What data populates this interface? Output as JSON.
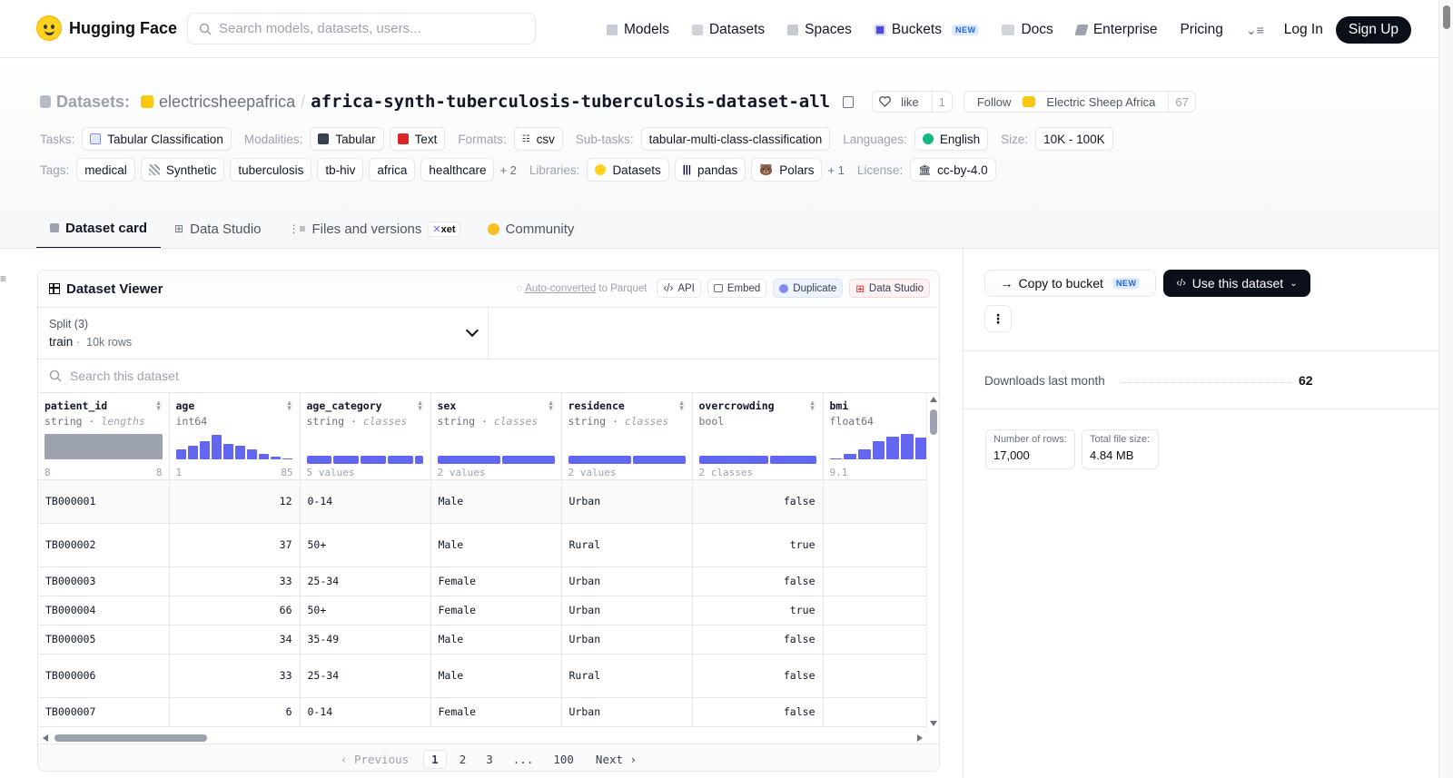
{
  "nav": {
    "brand": "Hugging Face",
    "search_placeholder": "Search models, datasets, users...",
    "links": [
      {
        "label": "Models",
        "icon": "cube-icon"
      },
      {
        "label": "Datasets",
        "icon": "database-icon"
      },
      {
        "label": "Spaces",
        "icon": "grid-icon"
      },
      {
        "label": "Buckets",
        "icon": "bucket-icon",
        "badge": "NEW"
      },
      {
        "label": "Docs",
        "icon": "book-icon"
      },
      {
        "label": "Enterprise",
        "icon": "enterprise-icon"
      },
      {
        "label": "Pricing"
      }
    ],
    "login": "Log In",
    "signup": "Sign Up"
  },
  "repo": {
    "kind_label": "Datasets:",
    "org": "electricsheepafrica",
    "name": "africa-synth-tuberculosis-tuberculosis-dataset-all",
    "like_label": "like",
    "like_count": "1",
    "follow_label": "Follow",
    "follow_org": "Electric Sheep Africa",
    "follow_count": "67"
  },
  "meta": {
    "tasks_label": "Tasks:",
    "task": "Tabular Classification",
    "modalities_label": "Modalities:",
    "modalities": [
      "Tabular",
      "Text"
    ],
    "formats_label": "Formats:",
    "format": "csv",
    "subtasks_label": "Sub-tasks:",
    "subtask": "tabular-multi-class-classification",
    "languages_label": "Languages:",
    "language": "English",
    "size_label": "Size:",
    "size": "10K - 100K",
    "tags_label": "Tags:",
    "tags": [
      "medical",
      "Synthetic",
      "tuberculosis",
      "tb-hiv",
      "africa",
      "healthcare"
    ],
    "tags_more": "+ 2",
    "libraries_label": "Libraries:",
    "libraries": [
      "Datasets",
      "pandas",
      "Polars"
    ],
    "libraries_more": "+ 1",
    "license_label": "License:",
    "license": "cc-by-4.0"
  },
  "tabs": {
    "card": "Dataset card",
    "studio": "Data Studio",
    "files": "Files and versions",
    "files_badge": "xet",
    "community": "Community"
  },
  "viewer": {
    "title": "Dataset Viewer",
    "auto_converted": "Auto-converted",
    "to_parquet": " to Parquet",
    "api": "API",
    "embed": "Embed",
    "duplicate": "Duplicate",
    "data_studio": "Data Studio",
    "split_label": "Split (3)",
    "split_name": "train",
    "split_rows": "10k rows",
    "search_placeholder": "Search this dataset",
    "columns": [
      {
        "name": "patient_id",
        "type": "string",
        "stat": "lengths",
        "min": "8",
        "max": "8"
      },
      {
        "name": "age",
        "type": "int64",
        "stat": "",
        "min": "1",
        "max": "85",
        "hist": [
          0.4,
          0.55,
          0.7,
          0.95,
          0.6,
          0.55,
          0.4,
          0.22,
          0.1,
          0.05
        ]
      },
      {
        "name": "age_category",
        "type": "string",
        "stat": "classes",
        "summary": "5 values"
      },
      {
        "name": "sex",
        "type": "string",
        "stat": "classes",
        "summary": "2 values"
      },
      {
        "name": "residence",
        "type": "string",
        "stat": "classes",
        "summary": "2 values"
      },
      {
        "name": "overcrowding",
        "type": "bool",
        "stat": "",
        "summary": "2 classes"
      },
      {
        "name": "bmi",
        "type": "float64",
        "stat": "",
        "min": "9.1",
        "hist": [
          0.05,
          0.2,
          0.4,
          0.7,
          0.9,
          1.0,
          0.85
        ]
      }
    ],
    "rows": [
      {
        "patient_id": "TB000001",
        "age": "12",
        "age_category": "0-14",
        "sex": "Male",
        "residence": "Urban",
        "overcrowding": "false"
      },
      {
        "patient_id": "TB000002",
        "age": "37",
        "age_category": "50+",
        "sex": "Male",
        "residence": "Rural",
        "overcrowding": "true"
      },
      {
        "patient_id": "TB000003",
        "age": "33",
        "age_category": "25-34",
        "sex": "Female",
        "residence": "Urban",
        "overcrowding": "false"
      },
      {
        "patient_id": "TB000004",
        "age": "66",
        "age_category": "50+",
        "sex": "Female",
        "residence": "Urban",
        "overcrowding": "true"
      },
      {
        "patient_id": "TB000005",
        "age": "34",
        "age_category": "35-49",
        "sex": "Male",
        "residence": "Urban",
        "overcrowding": "false"
      },
      {
        "patient_id": "TB000006",
        "age": "33",
        "age_category": "25-34",
        "sex": "Male",
        "residence": "Rural",
        "overcrowding": "false"
      },
      {
        "patient_id": "TB000007",
        "age": "6",
        "age_category": "0-14",
        "sex": "Female",
        "residence": "Urban",
        "overcrowding": "false"
      }
    ],
    "pager": {
      "prev": "Previous",
      "pages": [
        "1",
        "2",
        "3",
        "...",
        "100"
      ],
      "current": "1",
      "next": "Next"
    }
  },
  "sidebar": {
    "copy_bucket": "Copy to bucket",
    "copy_badge": "NEW",
    "use_dataset": "Use this dataset",
    "downloads_label": "Downloads last month",
    "downloads_value": "62",
    "rows_label": "Number of rows:",
    "rows_value": "17,000",
    "size_label": "Total file size:",
    "size_value": "4.84 MB"
  },
  "colors": {
    "accent": "#6366f1",
    "brand": "#ffd21e",
    "dark": "#0b0f19"
  }
}
